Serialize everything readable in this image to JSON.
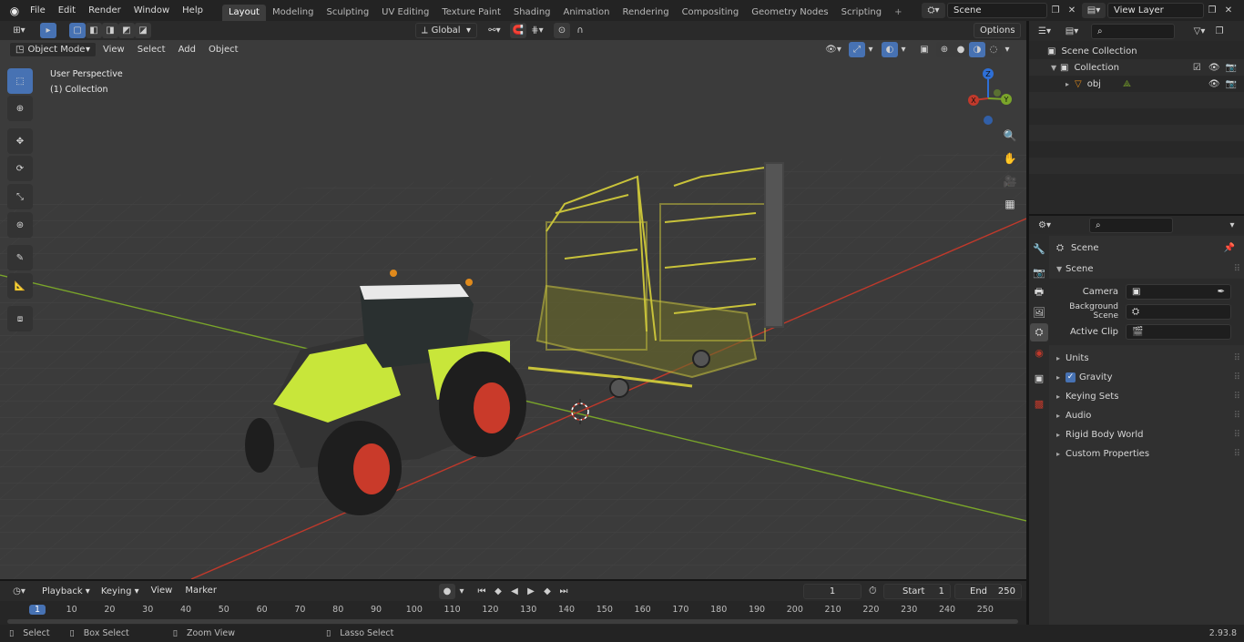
{
  "menus": [
    "File",
    "Edit",
    "Render",
    "Window",
    "Help"
  ],
  "workspaces": [
    {
      "label": "Layout",
      "active": true
    },
    {
      "label": "Modeling"
    },
    {
      "label": "Sculpting"
    },
    {
      "label": "UV Editing"
    },
    {
      "label": "Texture Paint"
    },
    {
      "label": "Shading"
    },
    {
      "label": "Animation"
    },
    {
      "label": "Rendering"
    },
    {
      "label": "Compositing"
    },
    {
      "label": "Geometry Nodes"
    },
    {
      "label": "Scripting"
    }
  ],
  "add_tab_label": "+",
  "scene_field": "Scene",
  "view_layer_field": "View Layer",
  "viewport_header": {
    "mode": "Object Mode",
    "menu": [
      "View",
      "Select",
      "Add",
      "Object"
    ],
    "orientation": "Global",
    "options": "Options"
  },
  "viewport_overlay": {
    "perspective": "User Perspective",
    "collection": "(1) Collection"
  },
  "gizmo": {
    "z": "Z",
    "y": "Y",
    "x": "X"
  },
  "outliner": {
    "root": "Scene Collection",
    "collection": "Collection",
    "object": "obj"
  },
  "properties": {
    "context": "Scene",
    "section": "Scene",
    "fields": [
      {
        "label": "Camera",
        "value": ""
      },
      {
        "label": "Background Scene",
        "value": ""
      },
      {
        "label": "Active Clip",
        "value": ""
      }
    ],
    "panels": [
      "Units",
      "Gravity",
      "Keying Sets",
      "Audio",
      "Rigid Body World",
      "Custom Properties"
    ],
    "gravity_checked": true
  },
  "timeline": {
    "menu": [
      "Playback",
      "Keying",
      "View",
      "Marker"
    ],
    "current_frame": "1",
    "start_label": "Start",
    "start": "1",
    "end_label": "End",
    "end": "250",
    "ruler": [
      "1",
      "10",
      "20",
      "30",
      "40",
      "50",
      "60",
      "70",
      "80",
      "90",
      "100",
      "110",
      "120",
      "130",
      "140",
      "150",
      "160",
      "170",
      "180",
      "190",
      "200",
      "210",
      "220",
      "230",
      "240",
      "250"
    ]
  },
  "statusbar": {
    "select": "Select",
    "box_select": "Box Select",
    "zoom_view": "Zoom View",
    "lasso_select": "Lasso Select",
    "version": "2.93.8"
  },
  "colors": {
    "accent": "#4772b3",
    "x_axis": "#c0392b",
    "y_axis": "#7aa52a",
    "z_axis": "#2e6fd6",
    "tractor": "#c8e63a",
    "wheel": "#c93a2a"
  }
}
